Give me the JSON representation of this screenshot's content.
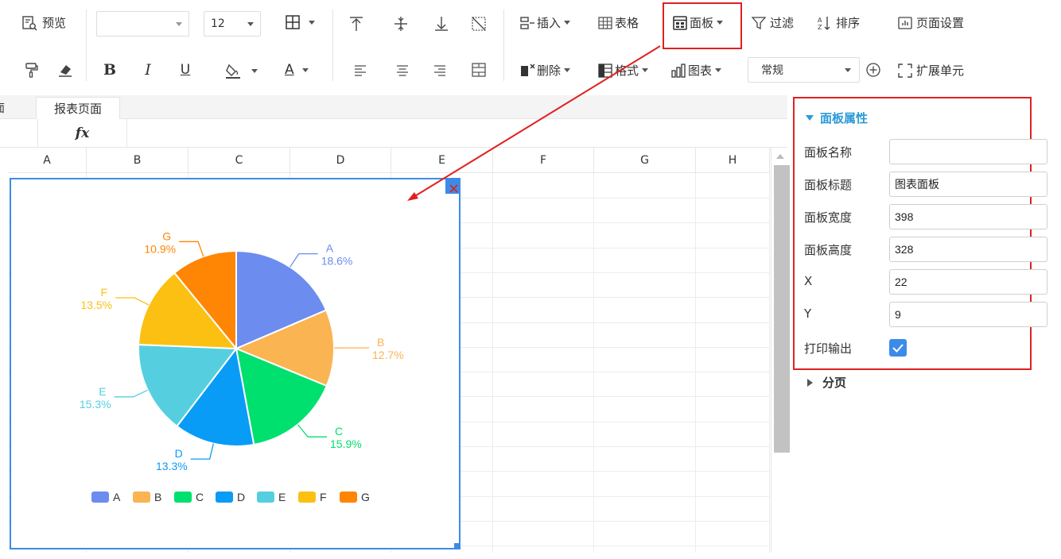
{
  "toolbar": {
    "preview": "预览",
    "font_name": "",
    "font_size": "12",
    "bold": "B",
    "italic": "I",
    "underline": "U",
    "font_color_letter": "A",
    "insert": "插入",
    "table": "表格",
    "panel": "面板",
    "filter": "过滤",
    "sort": "排序",
    "page_setup": "页面设置",
    "delete": "删除",
    "format": "格式",
    "chart": "图表",
    "number_format": "常规",
    "expand_cell": "扩展单元",
    "fx": "fx"
  },
  "tabs": {
    "prev_tab_fragment": "面",
    "active": "报表页面"
  },
  "columns": [
    "A",
    "B",
    "C",
    "D",
    "E",
    "F",
    "G",
    "H"
  ],
  "properties_panel": {
    "title": "面板属性",
    "fields": [
      {
        "label": "面板名称",
        "value": ""
      },
      {
        "label": "面板标题",
        "value": "图表面板"
      },
      {
        "label": "面板宽度",
        "value": "398"
      },
      {
        "label": "面板高度",
        "value": "328"
      },
      {
        "label": "X",
        "value": "22"
      },
      {
        "label": "Y",
        "value": "9"
      }
    ],
    "print_label": "打印输出",
    "print_checked": true,
    "paging": "分页"
  },
  "colors": {
    "highlight": "#e02020",
    "accent": "#3d8be8",
    "panel_title": "#2b9ad8"
  },
  "chart_data": {
    "type": "pie",
    "categories": [
      "A",
      "B",
      "C",
      "D",
      "E",
      "F",
      "G"
    ],
    "values": [
      18.6,
      12.7,
      15.9,
      13.3,
      15.3,
      13.5,
      10.9
    ],
    "labels": [
      "18.6%",
      "12.7%",
      "15.9%",
      "13.3%",
      "15.3%",
      "13.5%",
      "10.9%"
    ],
    "colors": [
      "#6c8cf0",
      "#fab452",
      "#00e06e",
      "#099cf6",
      "#55cfe0",
      "#fcc013",
      "#ff8505"
    ],
    "legend": "bottom"
  }
}
